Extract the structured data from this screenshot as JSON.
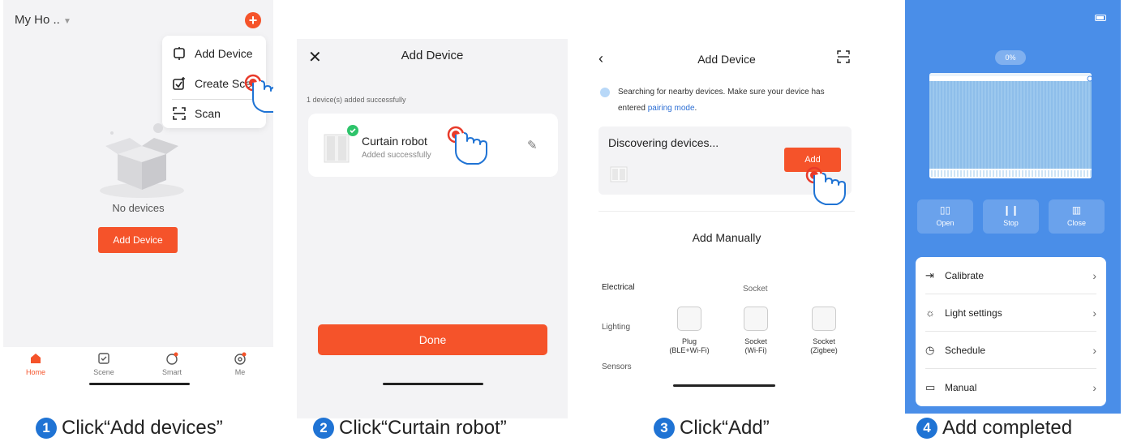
{
  "panel1": {
    "home_title": "My Ho ..",
    "menu": {
      "items": [
        "Add Device",
        "Create Scene",
        "Scan"
      ]
    },
    "empty_text": "No devices",
    "add_device_button": "Add Device",
    "tabs": [
      "Home",
      "Scene",
      "Smart",
      "Me"
    ]
  },
  "panel2": {
    "title": "Add Device",
    "added_message": "1 device(s) added successfully",
    "device_name": "Curtain robot",
    "device_status": "Added successfully",
    "done_button": "Done"
  },
  "panel3": {
    "title": "Add Device",
    "search_text": "Searching for nearby devices. Make sure your device has entered",
    "pairing_link": "pairing mode",
    "discovering_text": "Discovering devices...",
    "add_button": "Add",
    "add_manually": "Add Manually",
    "categories": [
      "Electrical",
      "Lighting",
      "Sensors"
    ],
    "socket_header": "Socket",
    "sockets": [
      {
        "line1": "Plug",
        "line2": "(BLE+Wi-Fi)"
      },
      {
        "line1": "Socket",
        "line2": "(Wi-Fi)"
      },
      {
        "line1": "Socket",
        "line2": "(Zigbee)"
      }
    ]
  },
  "panel4": {
    "percent": "0%",
    "controls": [
      "Open",
      "Stop",
      "Close"
    ],
    "settings": [
      "Calibrate",
      "Light settings",
      "Schedule",
      "Manual"
    ]
  },
  "captions": [
    {
      "num": "1",
      "text": "Click“Add devices”"
    },
    {
      "num": "2",
      "text": "Click“Curtain robot”"
    },
    {
      "num": "3",
      "text": "Click“Add”"
    },
    {
      "num": "4",
      "text": "Add completed"
    }
  ],
  "colors": {
    "accent": "#f5532a",
    "step_blue": "#1f73d4",
    "device_bg": "#4a8ee8"
  }
}
